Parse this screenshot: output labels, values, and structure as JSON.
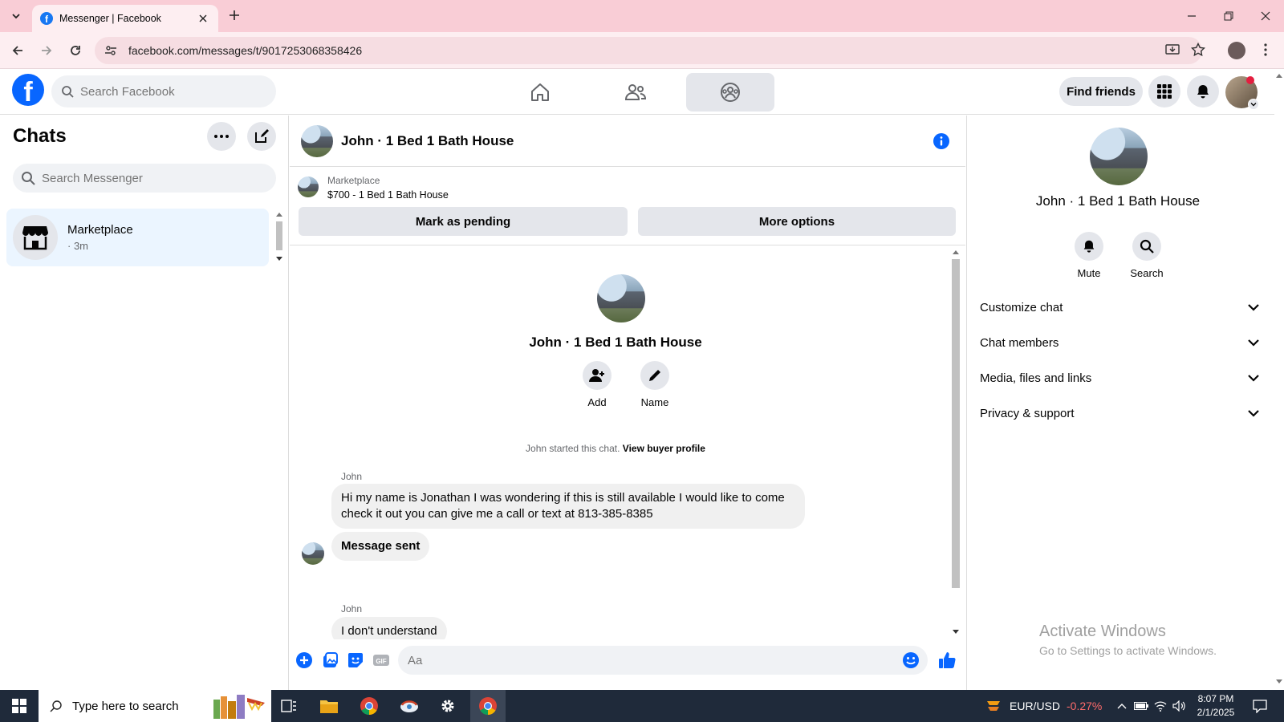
{
  "browser": {
    "tab_title": "Messenger | Facebook",
    "url": "facebook.com/messages/t/9017253068358426"
  },
  "fb": {
    "search_placeholder": "Search Facebook",
    "find_friends": "Find friends"
  },
  "left": {
    "title": "Chats",
    "search_placeholder": "Search Messenger",
    "chats": [
      {
        "name": "Marketplace",
        "time": "· 3m"
      }
    ]
  },
  "conversation": {
    "title": "John · 1 Bed 1 Bath House",
    "marketplace_label": "Marketplace",
    "listing": "$700 - 1 Bed 1 Bath House",
    "mark_pending": "Mark as pending",
    "more_options": "More options",
    "name": "John · 1 Bed 1 Bath House",
    "actions": [
      {
        "label": "Add"
      },
      {
        "label": "Name"
      }
    ],
    "started_text": "John started this chat.",
    "buyer_profile_link": "View buyer profile",
    "messages": [
      {
        "sender": "John",
        "text": "Hi my name is Jonathan I was wondering if this is still available I would like to come check it out you can give me a call or text at 813-385-8385"
      },
      {
        "sender": "",
        "text": "Message sent"
      },
      {
        "sender": "John",
        "text": "I don't understand"
      }
    ],
    "composer_placeholder": "Aa"
  },
  "right": {
    "name": "John · 1 Bed 1 Bath House",
    "actions": [
      {
        "label": "Mute"
      },
      {
        "label": "Search"
      }
    ],
    "sections": [
      "Customize chat",
      "Chat members",
      "Media, files and links",
      "Privacy & support"
    ],
    "watermark_title": "Activate Windows",
    "watermark_sub": "Go to Settings to activate Windows."
  },
  "taskbar": {
    "search_placeholder": "Type here to search",
    "ticker": "EUR/USD",
    "ticker_change": "-0.27%",
    "time": "8:07 PM",
    "date": "2/1/2025"
  },
  "colors": {
    "accent": "#0866ff",
    "tab_bar": "#f9cdd6",
    "selected_chat": "#ebf5ff",
    "ticker_negative": "#ff6b6b"
  }
}
